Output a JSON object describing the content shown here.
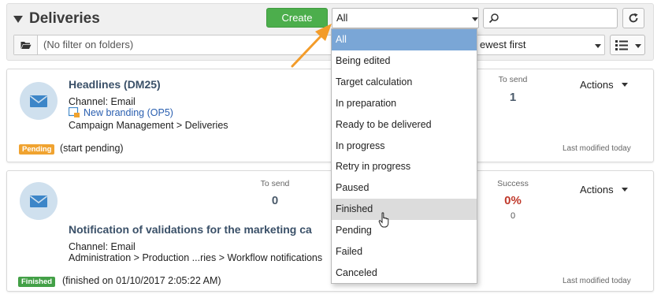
{
  "header": {
    "title": "Deliveries",
    "create_label": "Create",
    "status_filter_value": "All",
    "search_value": "",
    "folder_filter_placeholder": "(No filter on folders)",
    "sort_value": "ewest first"
  },
  "status_options": [
    {
      "label": "All",
      "state": "selected"
    },
    {
      "label": "Being edited",
      "state": "normal"
    },
    {
      "label": "Target calculation",
      "state": "normal"
    },
    {
      "label": "In preparation",
      "state": "normal"
    },
    {
      "label": "Ready to be delivered",
      "state": "normal"
    },
    {
      "label": "In progress",
      "state": "normal"
    },
    {
      "label": "Retry in progress",
      "state": "normal"
    },
    {
      "label": "Paused",
      "state": "normal"
    },
    {
      "label": "Finished",
      "state": "hover"
    },
    {
      "label": "Pending",
      "state": "normal"
    },
    {
      "label": "Failed",
      "state": "normal"
    },
    {
      "label": "Canceled",
      "state": "normal"
    }
  ],
  "deliveries": [
    {
      "name": "Headlines (DM25)",
      "channel": "Channel: Email",
      "operation_link": "New branding (OP5)",
      "folder_path": "Campaign Management > Deliveries",
      "to_send_label": "To send",
      "to_send_value": "1",
      "actions_label": "Actions",
      "status_badge": "Pending",
      "status_text": "(start pending)",
      "last_modified": "Last modified today"
    },
    {
      "name": "Notification of validations for the marketing ca",
      "channel": "Channel: Email",
      "folder_path": "Administration > Production ...ries > Workflow notifications",
      "to_send_label": "To send",
      "to_send_value": "0",
      "success_label": "Success",
      "success_percent": "0%",
      "success_count": "0",
      "actions_label": "Actions",
      "status_badge": "Finished",
      "status_text": "(finished on 01/10/2017 2:05:22 AM)",
      "last_modified": "Last modified today"
    }
  ],
  "colors": {
    "create_green": "#4cae4c",
    "selected_blue": "#7aa6d6",
    "pending_orange": "#f0a330",
    "finished_green": "#43a047",
    "success_red": "#c0392b",
    "annotation_arrow": "#f39c2a"
  }
}
